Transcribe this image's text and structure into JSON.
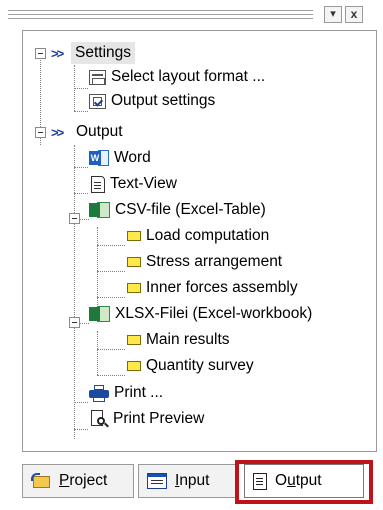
{
  "toolbar": {
    "dropdown_glyph": "▾",
    "close_glyph": "x"
  },
  "tree": {
    "settings": {
      "label": "Settings",
      "icon": "double-chevron-icon",
      "children": [
        {
          "label": "Select layout format ...",
          "icon": "layout-icon"
        },
        {
          "label": "Output settings",
          "icon": "checkbox-icon"
        }
      ]
    },
    "output": {
      "label": "Output",
      "icon": "double-chevron-icon",
      "word": {
        "label": "Word",
        "icon": "word-icon"
      },
      "textview": {
        "label": "Text-View",
        "icon": "text-document-icon"
      },
      "csv": {
        "label": "CSV-file (Excel-Table)",
        "icon": "excel-icon",
        "children": [
          {
            "label": "Load computation"
          },
          {
            "label": "Stress arrangement"
          },
          {
            "label": "Inner forces assembly"
          }
        ]
      },
      "xlsx": {
        "label": "XLSX-Filei (Excel-workbook)",
        "icon": "excel-icon",
        "children": [
          {
            "label": "Main results"
          },
          {
            "label": "Quantity survey"
          }
        ]
      },
      "print": {
        "label": "Print ...",
        "icon": "printer-icon"
      },
      "preview": {
        "label": "Print Preview",
        "icon": "print-preview-icon"
      }
    }
  },
  "tabs": {
    "project": {
      "label_u": "P",
      "label_rest": "roject",
      "icon": "project-icon"
    },
    "input": {
      "label_u": "I",
      "label_rest": "nput",
      "icon": "input-icon"
    },
    "output": {
      "label_pre": "O",
      "label_u": "u",
      "label_rest": "tput",
      "icon": "output-icon",
      "active": true
    }
  },
  "colors": {
    "highlight_frame": "#c0121a",
    "chevron": "#1f3f9a"
  }
}
